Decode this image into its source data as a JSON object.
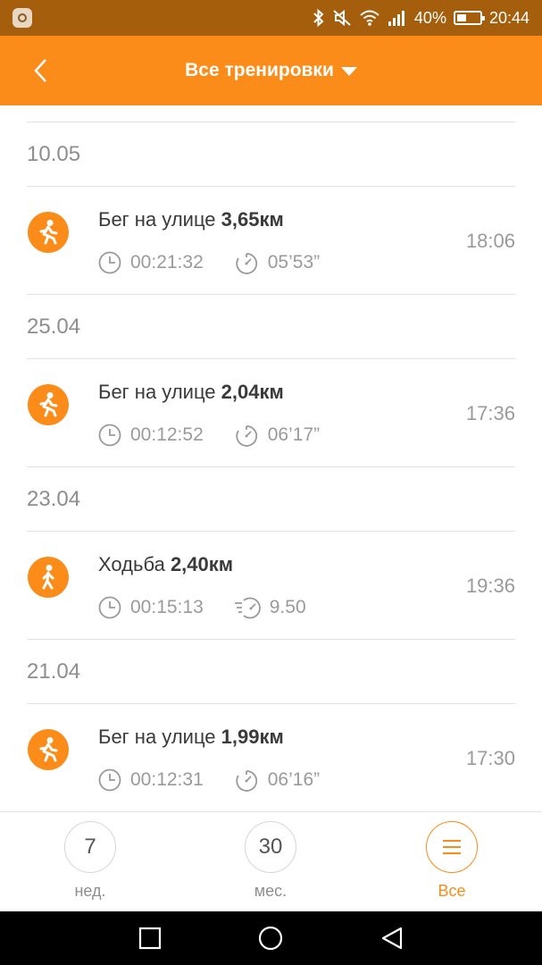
{
  "status_bar": {
    "battery_percent_text": "40%",
    "battery_level": 0.4,
    "clock": "20:44"
  },
  "header": {
    "title": "Все тренировки"
  },
  "workout_groups": [
    {
      "date": "10.05",
      "items": [
        {
          "activity": "Бег на улице",
          "distance": "3,65км",
          "duration": "00:21:32",
          "metric_icon": "pace-icon",
          "metric_value": "05’53”",
          "time": "18:06"
        }
      ]
    },
    {
      "date": "25.04",
      "items": [
        {
          "activity": "Бег на улице",
          "distance": "2,04км",
          "duration": "00:12:52",
          "metric_icon": "pace-icon",
          "metric_value": "06’17”",
          "time": "17:36"
        }
      ]
    },
    {
      "date": "23.04",
      "items": [
        {
          "activity": "Ходьба",
          "distance": "2,40км",
          "duration": "00:15:13",
          "metric_icon": "speed-icon",
          "metric_value": "9.50",
          "time": "19:36"
        }
      ]
    },
    {
      "date": "21.04",
      "items": [
        {
          "activity": "Бег на улице",
          "distance": "1,99км",
          "duration": "00:12:31",
          "metric_icon": "pace-icon",
          "metric_value": "06’16”",
          "time": "17:30"
        }
      ]
    }
  ],
  "bottom_tabs": [
    {
      "value": "7",
      "label": "нед.",
      "active": false
    },
    {
      "value": "30",
      "label": "мес.",
      "active": false
    },
    {
      "value": "",
      "label": "Все",
      "active": true
    }
  ],
  "colors": {
    "accent": "#FB8C1A",
    "status_bar": "#A55E0B",
    "text_primary": "#3A3A3A",
    "text_secondary": "#9A9A9A"
  }
}
